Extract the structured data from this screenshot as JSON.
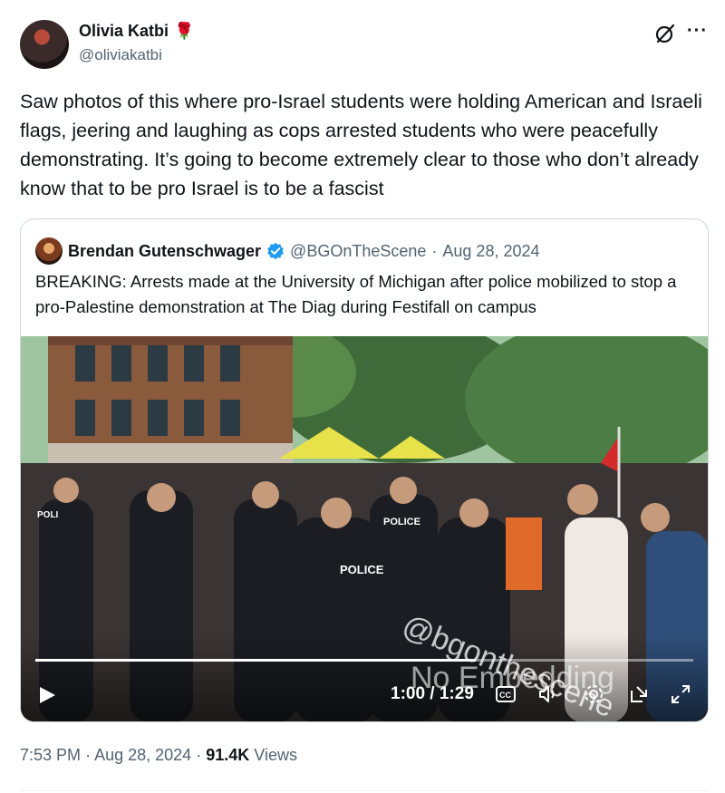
{
  "author": {
    "name": "Olivia Katbi",
    "name_emoji": "🌹",
    "handle": "@oliviakatbi"
  },
  "icons": {
    "grok": "grok-icon",
    "more": "more-icon",
    "verified": "verified-badge-icon",
    "play": "play-icon",
    "captions": "captions-icon",
    "volume": "volume-icon",
    "settings": "gear-icon",
    "popout": "popout-icon",
    "fullscreen": "fullscreen-icon"
  },
  "more_label": "···",
  "tweet_text": "Saw photos of this where pro-Israel students were holding American and Israeli flags, jeering and laughing as cops arrested students who were peacefully demonstrating. It’s going to become extremely clear to those who don’t already know that to be pro Israel is to be a fascist",
  "quoted": {
    "name": "Brendan Gutenschwager",
    "handle": "@BGOnTheScene",
    "separator": "·",
    "date": "Aug 28, 2024",
    "text": "BREAKING: Arrests made at the University of Michigan after police mobilized to stop a pro-Palestine demonstration at The Diag during Festifall on campus",
    "video": {
      "watermark": "@bgonthescene",
      "overlay": "No Embedding",
      "time": "1:00 / 1:29",
      "progress": 0.67,
      "vest_label": "POLICE",
      "vest_label_short": "POLI"
    }
  },
  "footer": {
    "time": "7:53 PM",
    "dot": "·",
    "date": "Aug 28, 2024",
    "views_count": "91.4K",
    "views_label": "Views"
  },
  "colors": {
    "text": "#0f1419",
    "secondary": "#536471",
    "verified": "#1d9bf0",
    "border": "#cfd9de"
  }
}
